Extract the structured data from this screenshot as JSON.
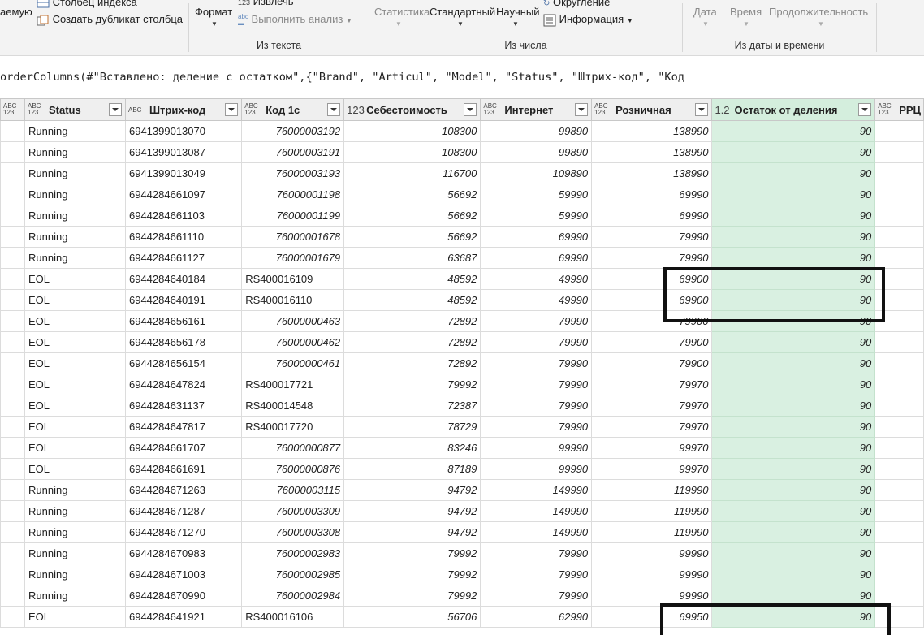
{
  "ribbon": {
    "col_index_label": "Столбец индекса",
    "duplicate_col_label": "Создать дубликат столбца",
    "partial_left_label": "аемую",
    "format_label": "Формат",
    "extract_label": "Извлечь",
    "analyze_label": "Выполнить анализ",
    "from_text_label": "Из текста",
    "statistics_label": "Статистика",
    "standard_label": "Стандартный",
    "scientific_label": "Научный",
    "rounding_label": "Округление",
    "info_label": "Информация",
    "from_number_label": "Из числа",
    "date_label": "Дата",
    "time_label": "Время",
    "duration_label": "Продолжительность",
    "from_datetime_label": "Из даты и времени"
  },
  "formula": "orderColumns(#\"Вставлено: деление с остатком\",{\"Brand\", \"Articul\", \"Model\", \"Status\", \"Штрих-код\", \"Код",
  "columns": [
    {
      "type": "ABC\n123",
      "name": ""
    },
    {
      "type": "ABC\n123",
      "name": "Status"
    },
    {
      "type": "ABC",
      "name": "Штрих-код"
    },
    {
      "type": "ABC\n123",
      "name": "Код 1с"
    },
    {
      "type": "123",
      "name": "Себестоимость"
    },
    {
      "type": "ABC\n123",
      "name": "Интернет"
    },
    {
      "type": "ABC\n123",
      "name": "Розничная"
    },
    {
      "type": "1.2",
      "name": "Остаток от деления"
    },
    {
      "type": "ABC\n123",
      "name": "РРЦ"
    }
  ],
  "rows": [
    [
      "Running",
      "6941399013070",
      "76000003192",
      "108300",
      "99890",
      "138990",
      "90"
    ],
    [
      "Running",
      "6941399013087",
      "76000003191",
      "108300",
      "99890",
      "138990",
      "90"
    ],
    [
      "Running",
      "6941399013049",
      "76000003193",
      "116700",
      "109890",
      "138990",
      "90"
    ],
    [
      "Running",
      "6944284661097",
      "76000001198",
      "56692",
      "59990",
      "69990",
      "90"
    ],
    [
      "Running",
      "6944284661103",
      "76000001199",
      "56692",
      "59990",
      "69990",
      "90"
    ],
    [
      "Running",
      "6944284661110",
      "76000001678",
      "56692",
      "69990",
      "79990",
      "90"
    ],
    [
      "Running",
      "6944284661127",
      "76000001679",
      "63687",
      "69990",
      "79990",
      "90"
    ],
    [
      "EOL",
      "6944284640184",
      "RS400016109",
      "48592",
      "49990",
      "69900",
      "90"
    ],
    [
      "EOL",
      "6944284640191",
      "RS400016110",
      "48592",
      "49990",
      "69900",
      "90"
    ],
    [
      "EOL",
      "6944284656161",
      "76000000463",
      "72892",
      "79990",
      "79900",
      "90"
    ],
    [
      "EOL",
      "6944284656178",
      "76000000462",
      "72892",
      "79990",
      "79900",
      "90"
    ],
    [
      "EOL",
      "6944284656154",
      "76000000461",
      "72892",
      "79990",
      "79900",
      "90"
    ],
    [
      "EOL",
      "6944284647824",
      "RS400017721",
      "79992",
      "79990",
      "79970",
      "90"
    ],
    [
      "EOL",
      "6944284631137",
      "RS400014548",
      "72387",
      "79990",
      "79970",
      "90"
    ],
    [
      "EOL",
      "6944284647817",
      "RS400017720",
      "78729",
      "79990",
      "79970",
      "90"
    ],
    [
      "EOL",
      "6944284661707",
      "76000000877",
      "83246",
      "99990",
      "99970",
      "90"
    ],
    [
      "EOL",
      "6944284661691",
      "76000000876",
      "87189",
      "99990",
      "99970",
      "90"
    ],
    [
      "Running",
      "6944284671263",
      "76000003115",
      "94792",
      "149990",
      "119990",
      "90"
    ],
    [
      "Running",
      "6944284671287",
      "76000003309",
      "94792",
      "149990",
      "119990",
      "90"
    ],
    [
      "Running",
      "6944284671270",
      "76000003308",
      "94792",
      "149990",
      "119990",
      "90"
    ],
    [
      "Running",
      "6944284670983",
      "76000002983",
      "79992",
      "79990",
      "99990",
      "90"
    ],
    [
      "Running",
      "6944284671003",
      "76000002985",
      "79992",
      "79990",
      "99990",
      "90"
    ],
    [
      "Running",
      "6944284670990",
      "76000002984",
      "79992",
      "79990",
      "99990",
      "90"
    ],
    [
      "EOL",
      "6944284641921",
      "RS400016106",
      "56706",
      "62990",
      "69950",
      "90"
    ]
  ],
  "colors": {
    "selected_column": "#d9f0e1",
    "highlight_box": "#111111"
  }
}
